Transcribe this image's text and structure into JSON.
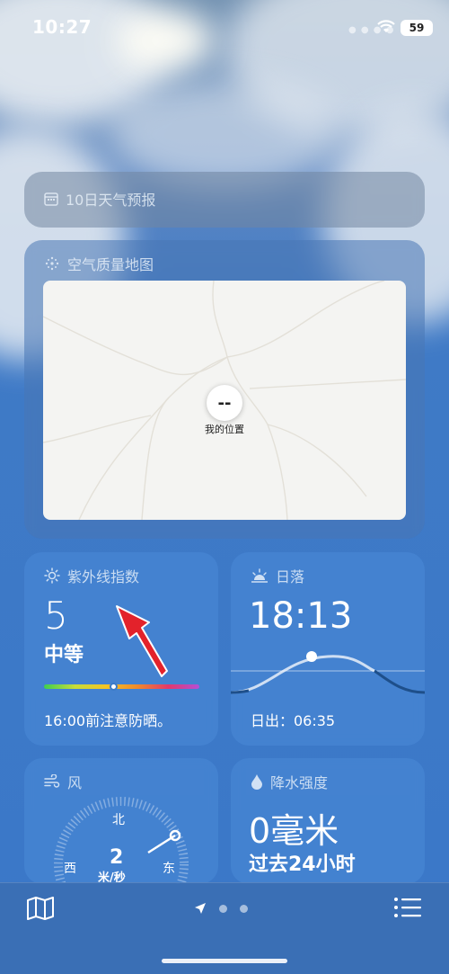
{
  "status_bar": {
    "time": "10:27",
    "battery": "59"
  },
  "forecast_card": {
    "title": "10日天气预报"
  },
  "air_quality": {
    "title": "空气质量地图",
    "pin_value": "--",
    "pin_label": "我的位置"
  },
  "uv_index": {
    "title": "紫外线指数",
    "value": "5",
    "level": "中等",
    "advice": "16:00前注意防晒。",
    "level_fraction": 0.45
  },
  "sunset": {
    "title": "日落",
    "time": "18:13",
    "sunrise": "日出：06:35"
  },
  "wind": {
    "title": "风",
    "north": "北",
    "west": "西",
    "east": "东",
    "speed": "2",
    "unit": "米/秒"
  },
  "precipitation": {
    "title": "降水强度",
    "amount": "0毫米",
    "period": "过去24小时"
  },
  "bottom_bar": {
    "icons": [
      "map-icon",
      "location-arrow-icon",
      "list-icon"
    ],
    "page_count": 3
  },
  "colors": {
    "accent": "#3a78c9",
    "annotation_arrow": "#e3222b"
  }
}
